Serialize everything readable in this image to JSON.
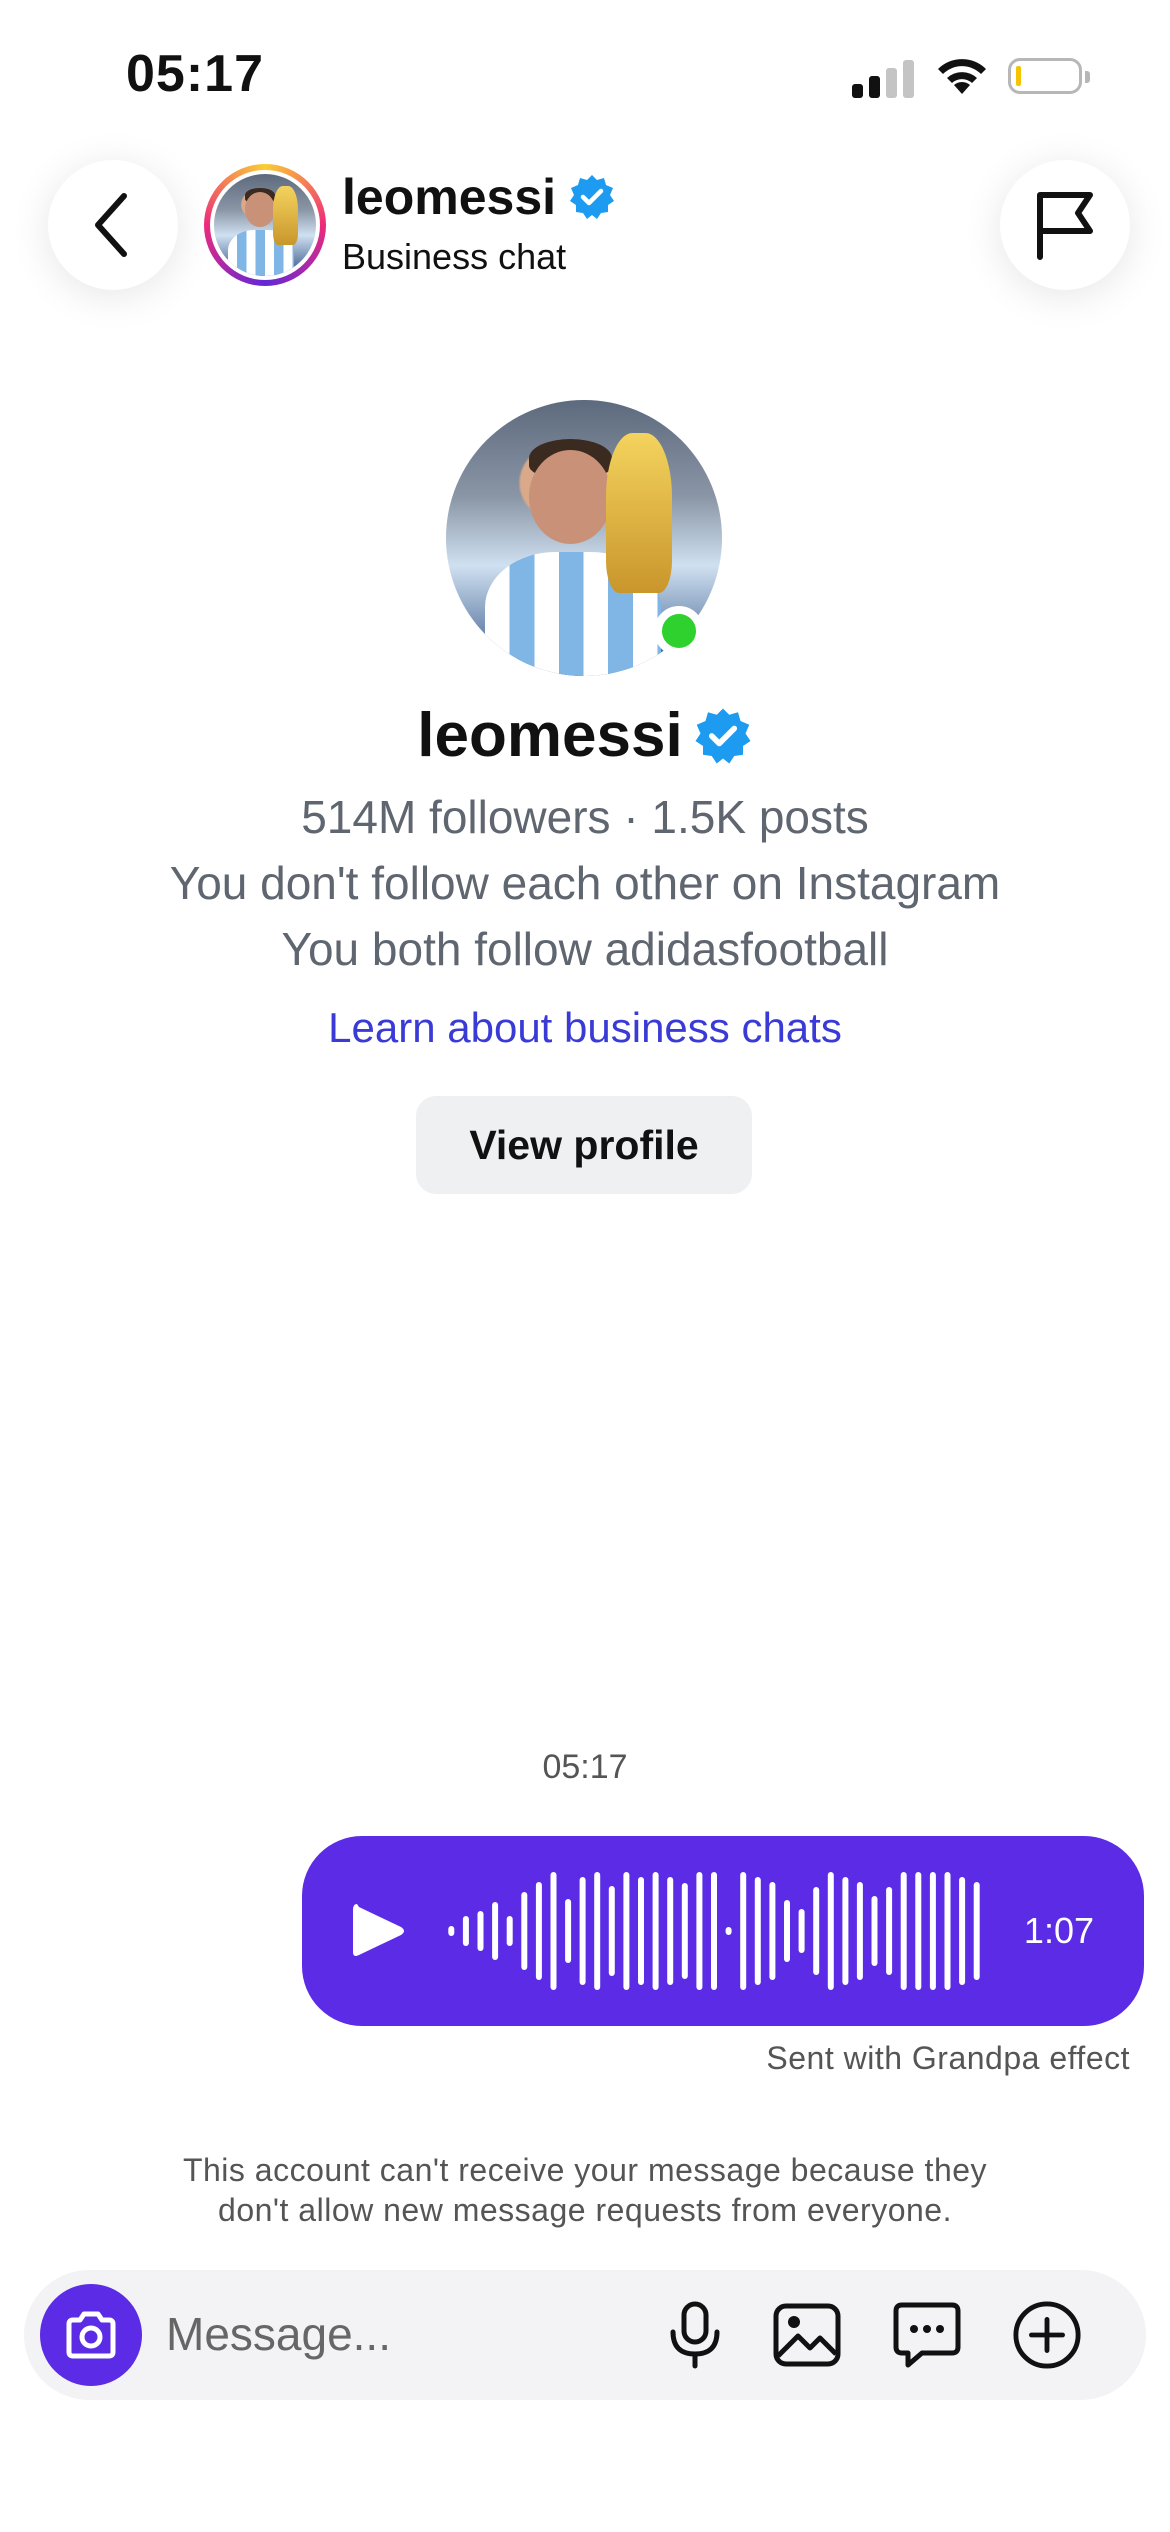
{
  "status_bar": {
    "time": "05:17"
  },
  "header": {
    "username": "leomessi",
    "subtitle": "Business chat",
    "back_icon": "chevron-left-icon",
    "report_icon": "flag-icon"
  },
  "profile": {
    "username": "leomessi",
    "verified": true,
    "online": true,
    "stats": "514M followers · 1.5K posts",
    "follow_status": "You don't follow each other on Instagram",
    "mutual": "You both follow adidasfootball",
    "learn_link": "Learn about business chats",
    "view_profile_label": "View profile"
  },
  "chat": {
    "timestamp": "05:17",
    "voice_message": {
      "duration": "1:07",
      "effect_note": "Sent with Grandpa effect"
    },
    "notice_lines": [
      "This account can't receive your message because they",
      "don't allow new message requests from everyone."
    ]
  },
  "composer": {
    "placeholder": "Message...",
    "icons": [
      "camera-icon",
      "microphone-icon",
      "gallery-icon",
      "sticker-chat-icon",
      "plus-icon"
    ]
  },
  "colors": {
    "accent": "#5b2be6",
    "link": "#3a3ad6",
    "verified": "#1d9bf0",
    "online": "#2ed12e"
  }
}
